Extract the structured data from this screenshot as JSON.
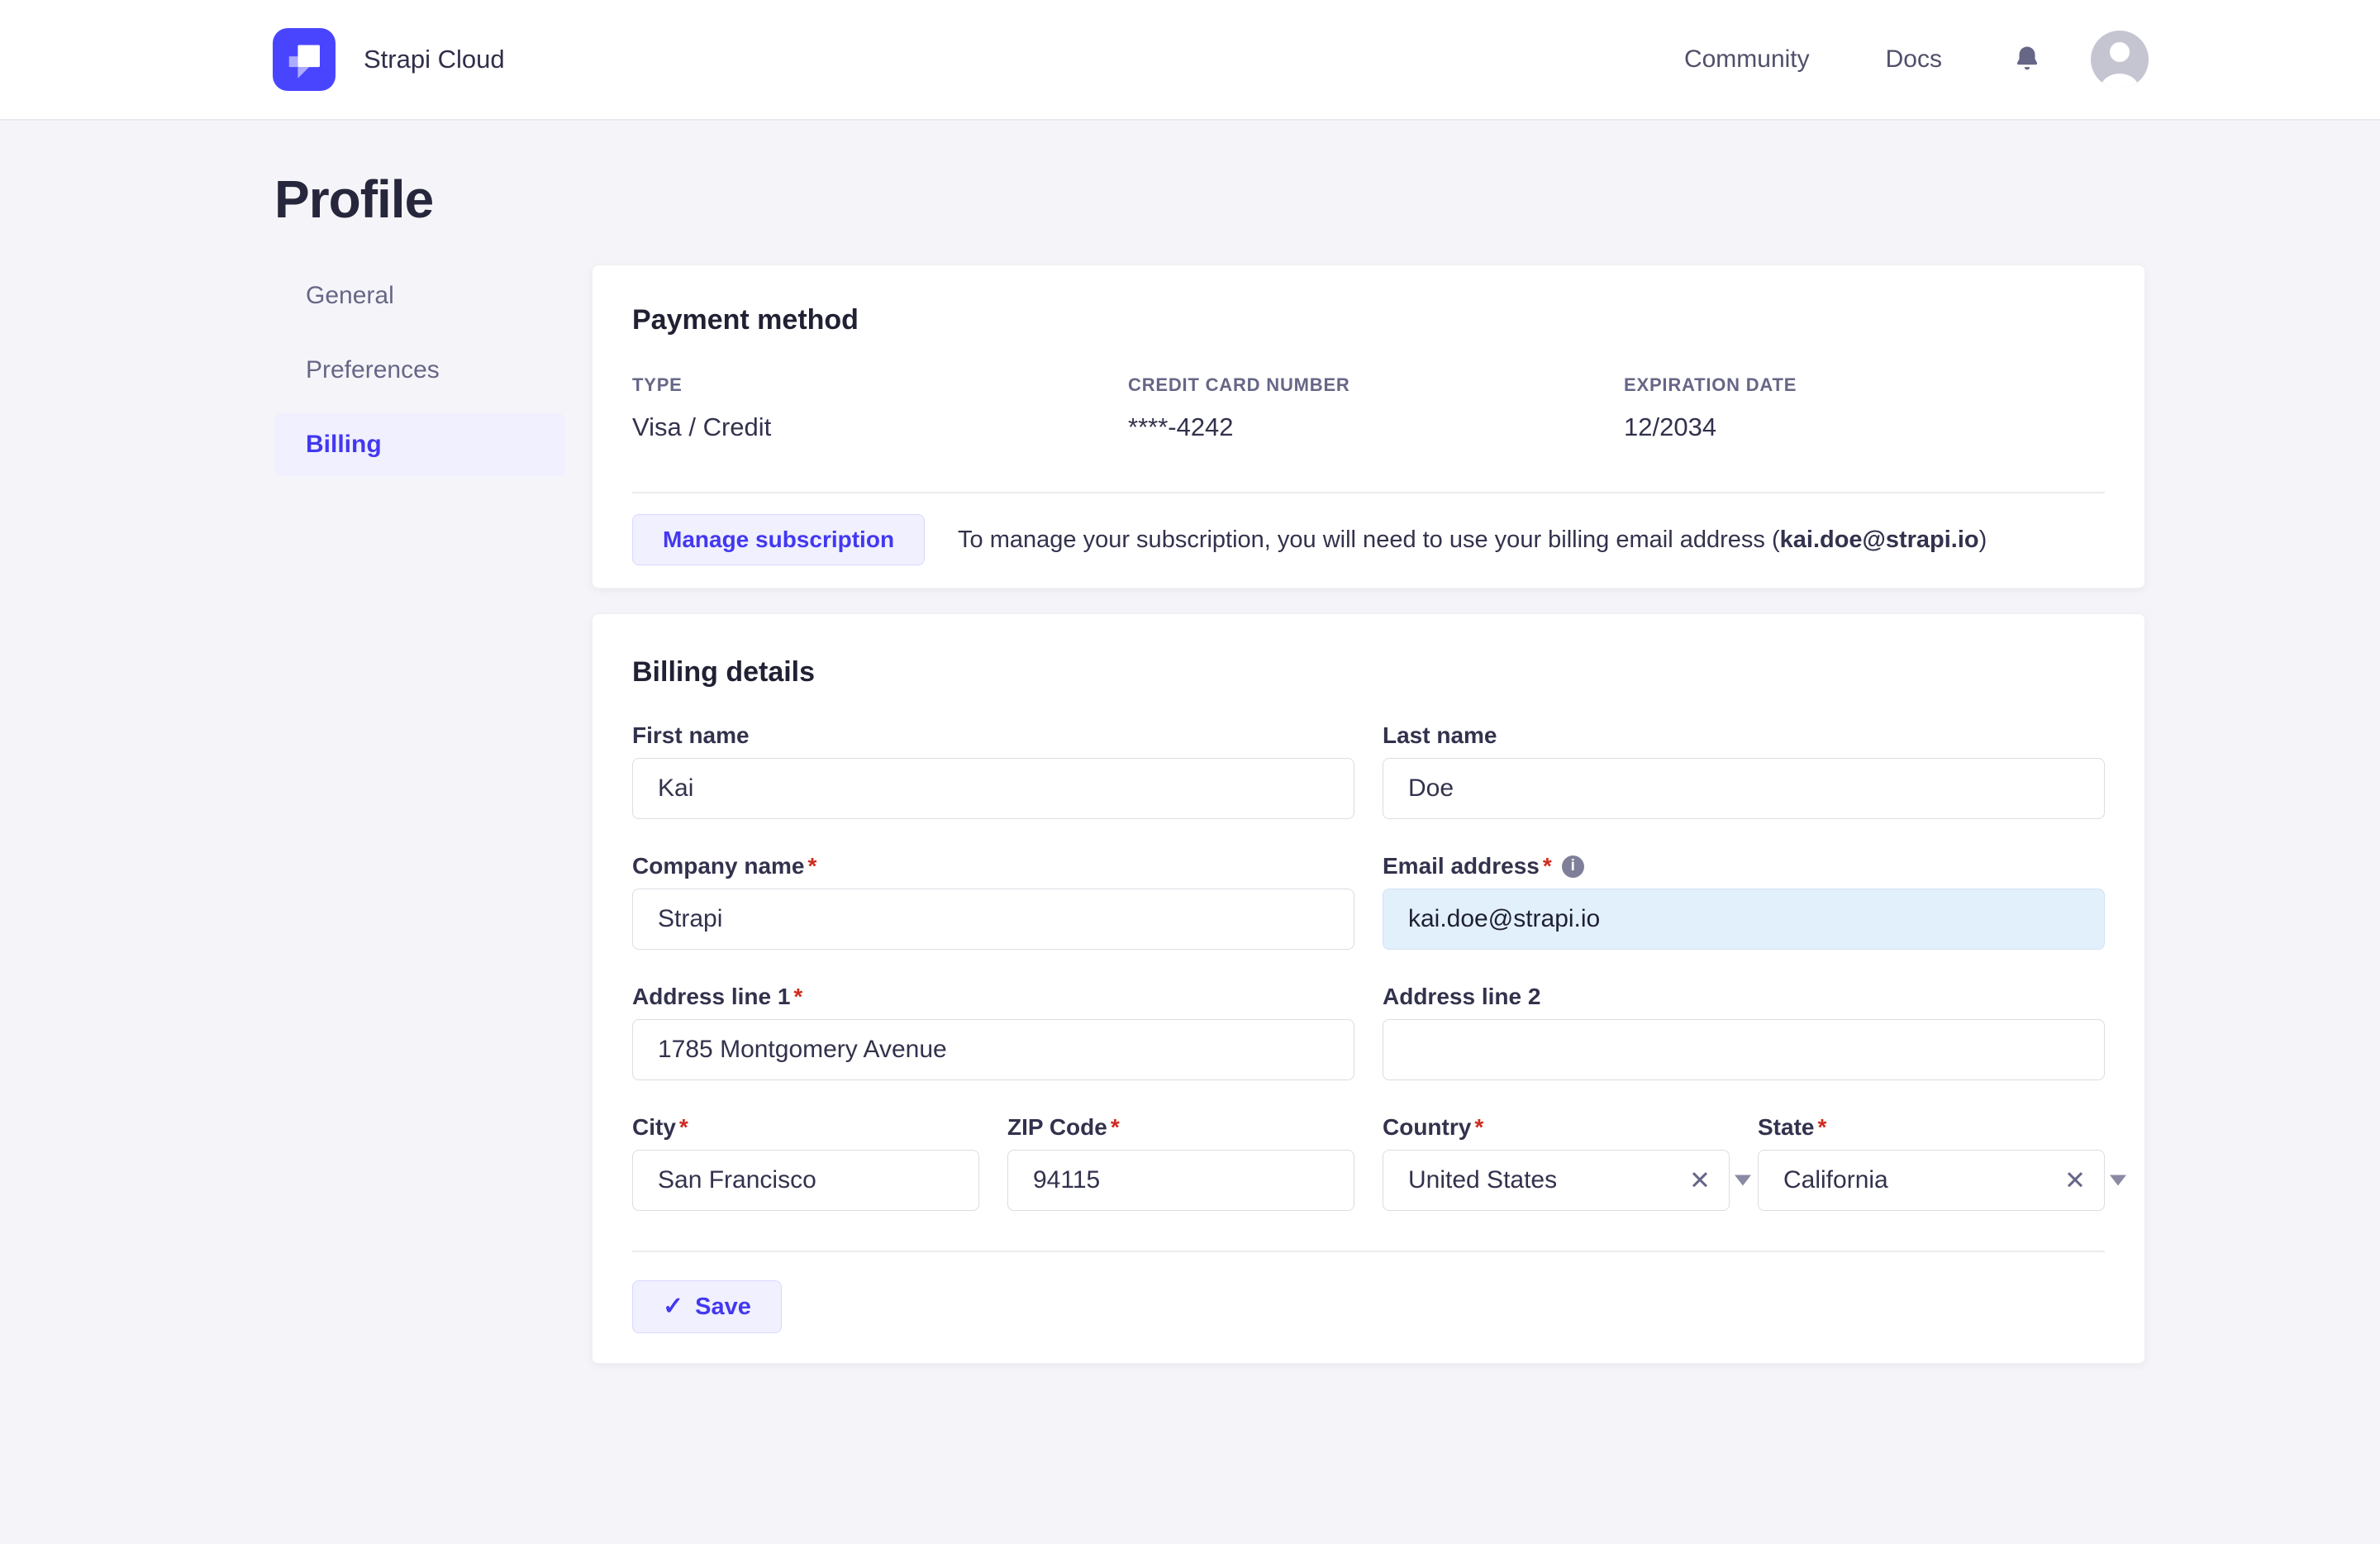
{
  "header": {
    "brand": "Strapi Cloud",
    "nav": [
      {
        "label": "Community"
      },
      {
        "label": "Docs"
      }
    ]
  },
  "page": {
    "title": "Profile"
  },
  "sidebar": {
    "items": [
      {
        "label": "General",
        "active": false
      },
      {
        "label": "Preferences",
        "active": false
      },
      {
        "label": "Billing",
        "active": true
      }
    ]
  },
  "payment": {
    "title": "Payment method",
    "fields": [
      {
        "label": "TYPE",
        "value": "Visa / Credit"
      },
      {
        "label": "CREDIT CARD NUMBER",
        "value": "****-4242"
      },
      {
        "label": "EXPIRATION DATE",
        "value": "12/2034"
      }
    ],
    "manage_button": "Manage subscription",
    "note_prefix": "To manage your subscription, you will need to use your billing email address (",
    "note_email": "kai.doe@strapi.io",
    "note_suffix": ")"
  },
  "billing": {
    "title": "Billing details",
    "required_marker": "*",
    "first_name": {
      "label": "First name",
      "value": "Kai",
      "required": false
    },
    "last_name": {
      "label": "Last name",
      "value": "Doe",
      "required": false
    },
    "company": {
      "label": "Company name",
      "value": "Strapi",
      "required": true
    },
    "email": {
      "label": "Email address",
      "value": "kai.doe@strapi.io",
      "required": true,
      "disabled": true
    },
    "address1": {
      "label": "Address line 1",
      "value": "1785 Montgomery Avenue",
      "required": true
    },
    "address2": {
      "label": "Address line 2",
      "value": "",
      "required": false
    },
    "city": {
      "label": "City",
      "value": "San Francisco",
      "required": true
    },
    "zip": {
      "label": "ZIP Code",
      "value": "94115",
      "required": true
    },
    "country": {
      "label": "Country",
      "value": "United States",
      "required": true
    },
    "state": {
      "label": "State",
      "value": "California",
      "required": true
    },
    "save_label": "Save"
  },
  "icons": {
    "info_icon": "i",
    "clear_icon": "✕",
    "check_icon": "✓"
  },
  "colors": {
    "accent": "#4338f0",
    "accent_bg": "#f0f0ff",
    "accent_border": "#d9d8ff",
    "logo": "#4945ff",
    "required": "#d02b20",
    "email_bg": "#e2f0fc"
  }
}
